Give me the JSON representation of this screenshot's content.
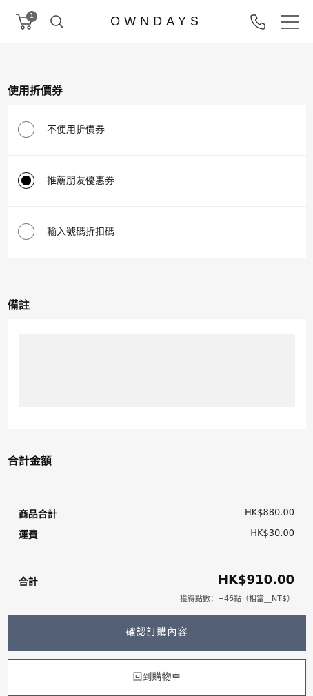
{
  "header": {
    "cart_count": "1",
    "logo": "OWNDAYS"
  },
  "coupon": {
    "title": "使用折價券",
    "options": [
      {
        "label": "不使用折價券",
        "selected": false
      },
      {
        "label": "推薦朋友優惠券",
        "selected": true
      },
      {
        "label": "輸入號碼折扣碼",
        "selected": false
      }
    ]
  },
  "notes": {
    "title": "備註",
    "value": ""
  },
  "summary": {
    "title": "合計金額",
    "subtotal_label": "商品合計",
    "subtotal_value": "HK$880.00",
    "shipping_label": "運費",
    "shipping_value": "HK$30.00",
    "total_label": "合計",
    "total_value": "HK$910.00",
    "points_text": "獲得點數：+46點（相當__NT$）"
  },
  "buttons": {
    "confirm": "確認訂購內容",
    "back": "回到購物車"
  }
}
